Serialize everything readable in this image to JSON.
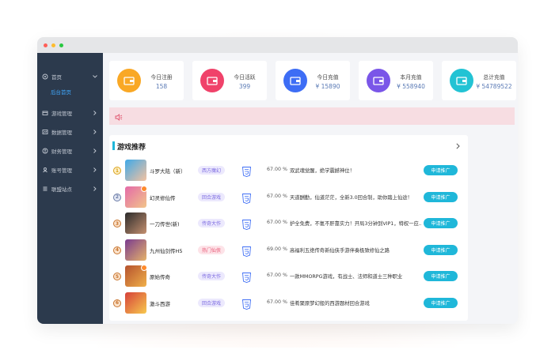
{
  "window_dots": [
    "#ff5f57",
    "#febc2e",
    "#28c840"
  ],
  "sidebar": {
    "items": [
      {
        "icon": "home-icon",
        "label": "首页",
        "expanded": true,
        "sub": [
          "后台首页"
        ]
      },
      {
        "icon": "gamepad-icon",
        "label": "游戏管理"
      },
      {
        "icon": "chart-icon",
        "label": "数据管理"
      },
      {
        "icon": "finance-icon",
        "label": "财务管理"
      },
      {
        "icon": "account-icon",
        "label": "账号管理"
      },
      {
        "icon": "link-icon",
        "label": "联盟站点"
      }
    ]
  },
  "stats": [
    {
      "label": "今日注册",
      "value": "158",
      "color": "#f9a825",
      "icon": "wallet-icon"
    },
    {
      "label": "今日活跃",
      "value": "399",
      "color": "#f0426a",
      "icon": "wallet-icon"
    },
    {
      "label": "今日充值",
      "value": "¥ 15890",
      "color": "#3d6df5",
      "icon": "wallet-icon"
    },
    {
      "label": "本月充值",
      "value": "¥ 558940",
      "color": "#7a56e8",
      "icon": "wallet-icon"
    },
    {
      "label": "总计充值",
      "value": "¥ 54789522",
      "color": "#22c3d4",
      "icon": "wallet-icon"
    }
  ],
  "notice": {
    "icon": "speaker-icon",
    "color": "#e0506a"
  },
  "panel": {
    "title": "游戏推荐",
    "games": [
      {
        "rank": "1",
        "name": "斗罗大陆（新）",
        "tag": "西方魔幻",
        "tag_style": "purple",
        "percent": "67.00 %",
        "desc": "双武魂觉醒，绝学震撼神位！",
        "button": "申请推广",
        "hot": false,
        "thumb_colors": [
          "#3fa9e8",
          "#f4c2a0"
        ]
      },
      {
        "rank": "2",
        "name": "幻灵修仙传",
        "tag": "回合游戏",
        "tag_style": "purple",
        "percent": "67.00 %",
        "desc": "天道酬勤，仙道茫茫，全新3.0回合制，助你踏上仙途！",
        "button": "申请推广",
        "hot": true,
        "thumb_colors": [
          "#e46aa8",
          "#f2c58a"
        ]
      },
      {
        "rank": "3",
        "name": "一刀传世(新)",
        "tag": "传奇大作",
        "tag_style": "purple",
        "percent": "67.00 %",
        "desc": "护全免费，不氪不肝靠实力！开局3分钟到VIP1，特权一应...",
        "button": "申请推广",
        "hot": false,
        "thumb_colors": [
          "#2b2b2b",
          "#c49070"
        ]
      },
      {
        "rank": "4",
        "name": "九州仙剑传H5",
        "tag": "热门仙侠",
        "tag_style": "pink",
        "percent": "69.00 %",
        "desc": "高福利五绝传奇新仙侠手游伴奏极致修仙之路",
        "button": "申请推广",
        "hot": false,
        "thumb_colors": [
          "#7a3b8f",
          "#e6b36a"
        ]
      },
      {
        "rank": "5",
        "name": "原始传奇",
        "tag": "传奇大作",
        "tag_style": "purple",
        "percent": "67.00 %",
        "desc": "一款MMORPG游戏，有战士、法师和道士三种职业",
        "button": "申请推广",
        "hot": true,
        "thumb_colors": [
          "#b5522e",
          "#f0b04a"
        ]
      },
      {
        "rank": "6",
        "name": "激斗西游",
        "tag": "回合游戏",
        "tag_style": "purple",
        "percent": "67.00 %",
        "desc": "佳肴聚原梦幻般的西游题材回合游戏",
        "button": "申请推广",
        "hot": false,
        "thumb_colors": [
          "#d6413a",
          "#f7c94e"
        ]
      }
    ]
  }
}
